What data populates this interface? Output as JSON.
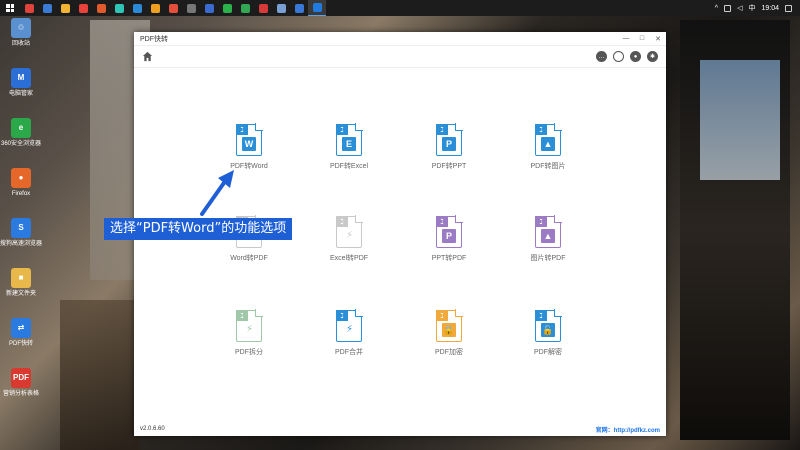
{
  "taskbar": {
    "time": "19:04",
    "ime": "中",
    "icon_colors": [
      "#e0433b",
      "#3a7bd5",
      "#f2b533",
      "#e8423a",
      "#e05a2b",
      "#2ec4b6",
      "#2b8ad8",
      "#f0a020",
      "#e34f3a",
      "#777777",
      "#3a6bd0",
      "#2bb24c",
      "#33a852",
      "#d83a3a",
      "#7aa0d6",
      "#3a78d8",
      "#1f7be0"
    ]
  },
  "desktop": {
    "icons": [
      {
        "label": "回收站",
        "icon": "recycle-bin-icon",
        "color": "#5a8fd0",
        "glyph": "♲"
      },
      {
        "label": "电脑管家",
        "icon": "pc-manager-icon",
        "color": "#2b6fd6",
        "glyph": "M"
      },
      {
        "label": "360安全浏览器",
        "icon": "360-browser-icon",
        "color": "#2aa84a",
        "glyph": "e"
      },
      {
        "label": "Firefox",
        "icon": "firefox-icon",
        "color": "#e5672a",
        "glyph": "●"
      },
      {
        "label": "搜狗高速浏览器",
        "icon": "sogou-browser-icon",
        "color": "#2a7ae0",
        "glyph": "S"
      },
      {
        "label": "新建文件夹",
        "icon": "folder-icon",
        "color": "#e8b84a",
        "glyph": "■"
      },
      {
        "label": "PDF快转",
        "icon": "pdf-app-icon",
        "color": "#2a7ae0",
        "glyph": "⇄"
      },
      {
        "label": "营销分析表格",
        "icon": "pdf-file-icon",
        "color": "#d93a2f",
        "glyph": "PDF"
      }
    ]
  },
  "window": {
    "title": "PDF快转",
    "controls": [
      "—",
      "□",
      "✕"
    ],
    "version": "v2.0.6.60",
    "site_label": "官网：http://pdfkz.com"
  },
  "features": [
    {
      "label": "PDF转Word",
      "icon": "pdf-to-word-icon",
      "color": "#2b8fd8",
      "letter": "W"
    },
    {
      "label": "PDF转Excel",
      "icon": "pdf-to-excel-icon",
      "color": "#2b8fd8",
      "letter": "E"
    },
    {
      "label": "PDF转PPT",
      "icon": "pdf-to-ppt-icon",
      "color": "#2b8fd8",
      "letter": "P"
    },
    {
      "label": "PDF转图片",
      "icon": "pdf-to-image-icon",
      "color": "#2b8fd8",
      "letter": "▲"
    },
    {
      "label": "Word转PDF",
      "icon": "word-to-pdf-icon",
      "color": "#c9c9c9",
      "letter": ""
    },
    {
      "label": "Excel转PDF",
      "icon": "excel-to-pdf-icon",
      "color": "#c9c9c9",
      "letter": ""
    },
    {
      "label": "PPT转PDF",
      "icon": "ppt-to-pdf-icon",
      "color": "#9b7bc4",
      "letter": "P"
    },
    {
      "label": "图片转PDF",
      "icon": "image-to-pdf-icon",
      "color": "#9b7bc4",
      "letter": "▲"
    },
    {
      "label": "PDF拆分",
      "icon": "pdf-split-icon",
      "color": "#a0c8a8",
      "letter": ""
    },
    {
      "label": "PDF合并",
      "icon": "pdf-merge-icon",
      "color": "#2b8fd8",
      "letter": ""
    },
    {
      "label": "PDF加密",
      "icon": "pdf-encrypt-icon",
      "color": "#f0a93a",
      "letter": "🔒"
    },
    {
      "label": "PDF解密",
      "icon": "pdf-decrypt-icon",
      "color": "#2b8fd8",
      "letter": "🔓"
    }
  ],
  "annotation": {
    "text": "选择“PDF转Word”的功能选项",
    "color": "#1f5fd6"
  }
}
